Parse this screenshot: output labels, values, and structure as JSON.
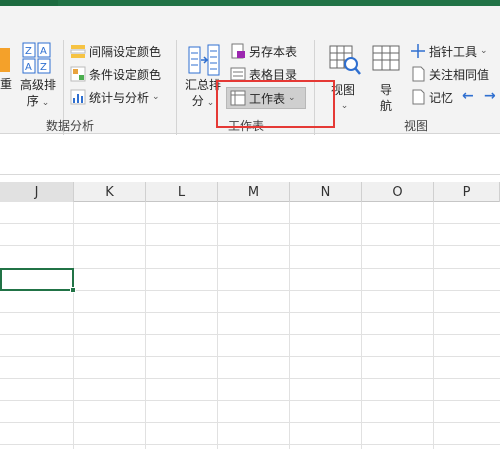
{
  "ribbon": {
    "partial_left_label_1": "重",
    "advanced_sort": {
      "label_line1": "高级排",
      "label_line2": "序"
    },
    "data_analysis_items": [
      "间隔设定颜色",
      "条件设定颜色",
      "统计与分析"
    ],
    "data_analysis_group_label": "数据分析",
    "summary_sort": {
      "label_line1": "汇总排",
      "label_line2": "分"
    },
    "worksheet_items": [
      "另存本表",
      "表格目录",
      "工作表"
    ],
    "worksheet_group_label": "工作表",
    "view_button": {
      "label_line1": "视图"
    },
    "navigate_button": {
      "label_line1": "导",
      "label_line2": "航"
    },
    "view_items": [
      "指针工具",
      "关注相同值",
      "记忆"
    ],
    "view_group_label": "视图"
  },
  "sheet": {
    "columns": [
      "J",
      "K",
      "L",
      "M",
      "N",
      "O",
      "P"
    ]
  }
}
